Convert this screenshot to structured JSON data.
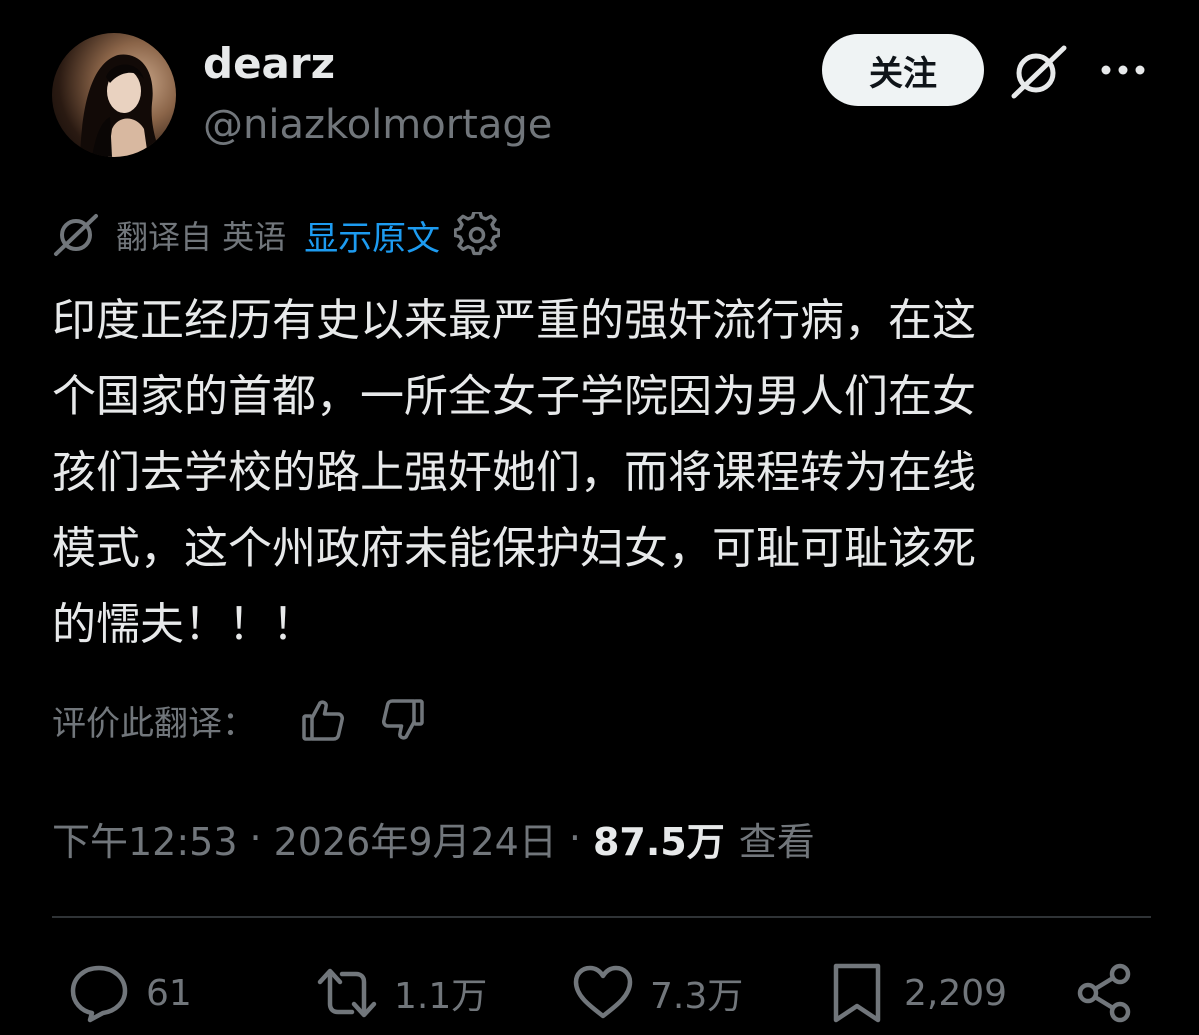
{
  "author": {
    "display_name": "dearz",
    "handle": "@niazkolmortage"
  },
  "header": {
    "follow_label": "关注"
  },
  "translation": {
    "label": "翻译自 英语",
    "show_original": "显示原文"
  },
  "post": {
    "lines": [
      "印度正经历有史以来最严重的强奸流行病，在这",
      "个国家的首都，一所全女子学院因为男人们在女",
      "孩们去学校的路上强奸她们，而将课程转为在线",
      "模式，这个州政府未能保护妇女，可耻可耻该死",
      "的懦夫！！！"
    ]
  },
  "rate": {
    "label": "评价此翻译："
  },
  "meta": {
    "time": "下午12:53",
    "separator": "·",
    "date": "2026年9月24日",
    "views_count": "87.5万",
    "views_label": "查看"
  },
  "actions": {
    "replies": "61",
    "retweets": "1.1万",
    "likes": "7.3万",
    "bookmarks": "2,209"
  },
  "colors": {
    "background": "#000000",
    "text_primary": "#e7e9ea",
    "text_secondary": "#71767b",
    "link": "#1d9bf0",
    "divider": "#2f3336",
    "follow_bg": "#eff3f4"
  },
  "icons": {
    "grok": "grok-icon",
    "more": "more-horizontal-icon",
    "translate": "grok-translate-icon",
    "settings": "gear-icon",
    "thumbs_up": "thumbs-up-icon",
    "thumbs_down": "thumbs-down-icon",
    "reply": "reply-icon",
    "retweet": "retweet-icon",
    "like": "heart-icon",
    "bookmark": "bookmark-icon",
    "share": "share-icon"
  }
}
